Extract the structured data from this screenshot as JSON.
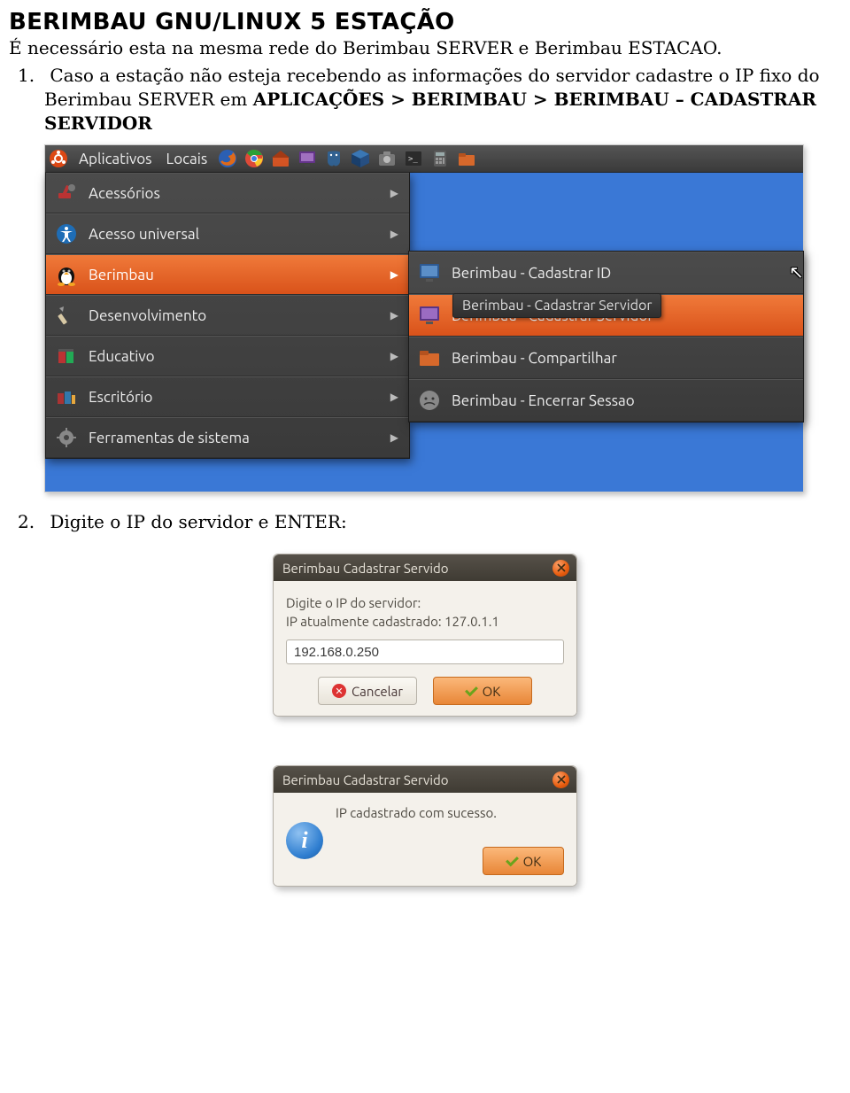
{
  "doc": {
    "title": "BERIMBAU GNU/LINUX 5 ESTAÇÃO",
    "intro": "É necessário esta na mesma rede do Berimbau SERVER e Berimbau ESTACAO.",
    "step1_pre": "Caso a estação não esteja recebendo as informações do servidor cadastre o IP fixo do Berimbau SERVER em ",
    "step1_bold": "APLICAÇÕES > BERIMBAU > BERIMBAU – CADASTRAR SERVIDOR",
    "step2": "Digite o IP do servidor e ENTER:"
  },
  "panel": {
    "applicativos": "Aplicativos",
    "locais": "Locais"
  },
  "left_menu": [
    {
      "label": "Acessórios",
      "icon": "accessories"
    },
    {
      "label": "Acesso universal",
      "icon": "accessibility"
    },
    {
      "label": "Berimbau",
      "icon": "penguin",
      "hover": true
    },
    {
      "label": "Desenvolvimento",
      "icon": "dev"
    },
    {
      "label": "Educativo",
      "icon": "edu"
    },
    {
      "label": "Escritório",
      "icon": "office"
    },
    {
      "label": "Ferramentas de sistema",
      "icon": "gear"
    }
  ],
  "right_menu": [
    {
      "label": "Berimbau - Cadastrar ID",
      "icon": "monitor-blue"
    },
    {
      "label": "Berimbau - Cadastrar Servidor",
      "icon": "monitor-purple",
      "hover": true
    },
    {
      "label": "Berimbau - Compartilhar",
      "icon": "folder"
    },
    {
      "label": "Berimbau - Encerrar Sessao",
      "icon": "face"
    }
  ],
  "tooltip": "Berimbau - Cadastrar Servidor",
  "dialog1": {
    "title": "Berimbau Cadastrar Servido",
    "line1": "Digite o IP do servidor:",
    "line2": "IP atualmente cadastrado: 127.0.1.1",
    "input_value": "192.168.0.250",
    "cancel": "Cancelar",
    "ok": "OK"
  },
  "dialog2": {
    "title": "Berimbau Cadastrar Servido",
    "message": "IP cadastrado com sucesso.",
    "ok": "OK"
  }
}
